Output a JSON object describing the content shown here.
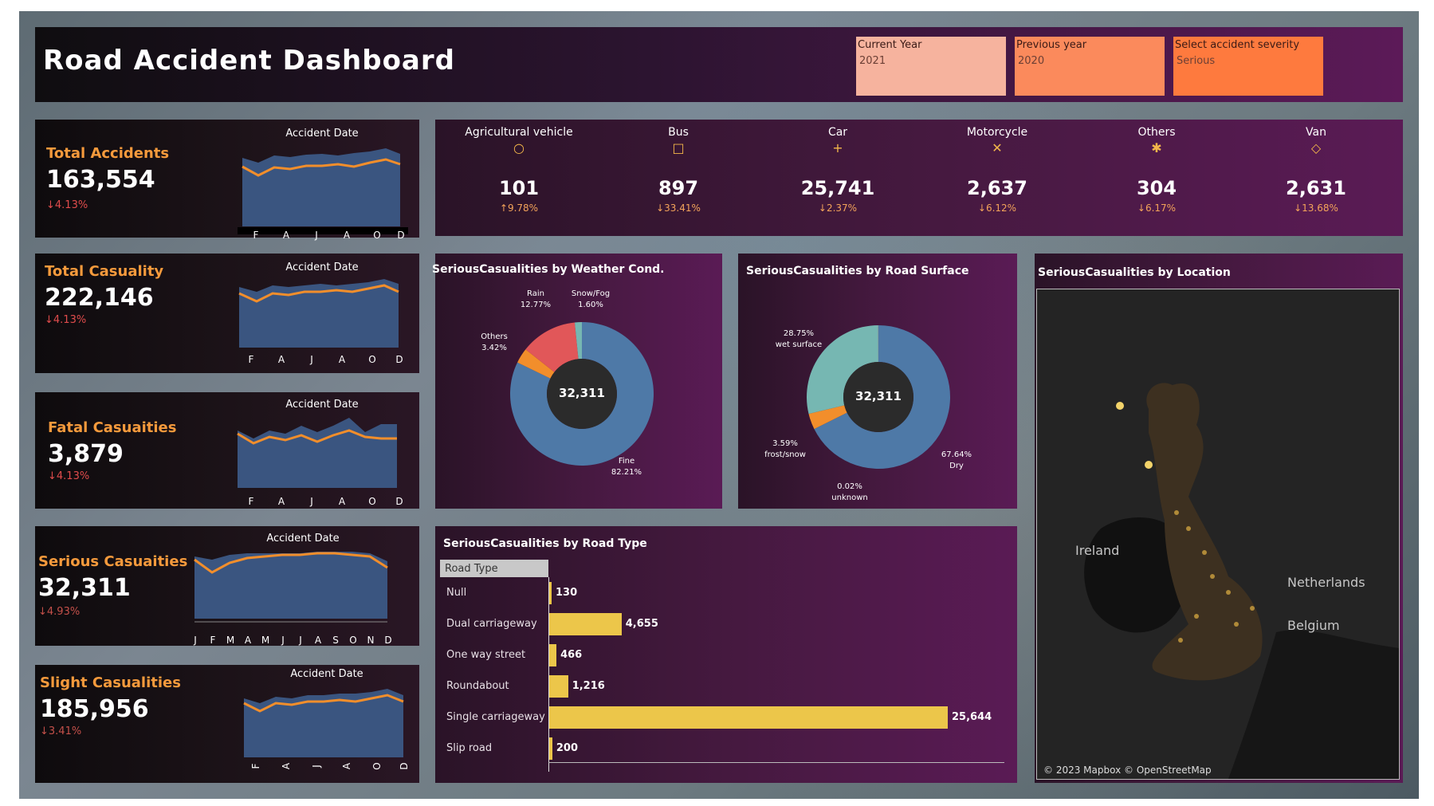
{
  "header": {
    "title": "Road Accident Dashboard",
    "filters": [
      {
        "label": "Current Year",
        "value": "2021",
        "color": "#f6b39e"
      },
      {
        "label": "Previous year",
        "value": "2020",
        "color": "#fb8a5c"
      },
      {
        "label": "Select accident severity",
        "value": "Serious",
        "color": "#fe7a3e"
      }
    ]
  },
  "kpis": {
    "total_accidents": {
      "label": "Total Accidents",
      "value": "163,554",
      "change": "↓4.13%",
      "axis_title": "Accident Date",
      "ticks": [
        "F",
        "A",
        "J",
        "A",
        "O",
        "D"
      ]
    },
    "total_casualty": {
      "label": "Total Casuality",
      "value": "222,146",
      "change": "↓4.13%",
      "axis_title": "Accident Date",
      "ticks": [
        "F",
        "A",
        "J",
        "A",
        "O",
        "D"
      ]
    },
    "fatal": {
      "label": "Fatal Casuaities",
      "value": "3,879",
      "change": "↓4.13%",
      "axis_title": "Accident Date",
      "ticks": [
        "F",
        "A",
        "J",
        "A",
        "O",
        "D"
      ]
    },
    "serious": {
      "label": "Serious Casuaities",
      "value": "32,311",
      "change": "↓4.93%",
      "axis_title": "Accident Date",
      "ticks": [
        "J",
        "F",
        "M",
        "A",
        "M",
        "J",
        "J",
        "A",
        "S",
        "O",
        "N",
        "D"
      ]
    },
    "slight": {
      "label": "Slight Casualities",
      "value": "185,956",
      "change": "↓3.41%",
      "axis_title": "Accident Date",
      "ticks": [
        "F",
        "A",
        "J",
        "A",
        "O",
        "D"
      ]
    }
  },
  "vehicles": [
    {
      "name": "Agricultural vehicle",
      "symbol": "○",
      "value": "101",
      "change": "↑9.78%"
    },
    {
      "name": "Bus",
      "symbol": "□",
      "value": "897",
      "change": "↓33.41%"
    },
    {
      "name": "Car",
      "symbol": "+",
      "value": "25,741",
      "change": "↓2.37%"
    },
    {
      "name": "Motorcycle",
      "symbol": "✕",
      "value": "2,637",
      "change": "↓6.12%"
    },
    {
      "name": "Others",
      "symbol": "✱",
      "value": "304",
      "change": "↓6.17%"
    },
    {
      "name": "Van",
      "symbol": "◇",
      "value": "2,631",
      "change": "↓13.68%"
    }
  ],
  "weather": {
    "title": "SeriousCasualities by Weather Cond.",
    "center": "32,311",
    "labels": [
      {
        "name": "Rain",
        "pct": "12.77%"
      },
      {
        "name": "Snow/Fog",
        "pct": "1.60%"
      },
      {
        "name": "Others",
        "pct": "3.42%"
      },
      {
        "name": "Fine",
        "pct": "82.21%"
      }
    ]
  },
  "surface": {
    "title": "SeriousCasualities by Road Surface",
    "center": "32,311",
    "labels": [
      {
        "name": "wet surface",
        "pct": "28.75%"
      },
      {
        "name": "frost/snow",
        "pct": "3.59%"
      },
      {
        "name": "unknown",
        "pct": "0.02%"
      },
      {
        "name": "Dry",
        "pct": "67.64%"
      }
    ]
  },
  "location": {
    "title": "SeriousCasualities by Location",
    "places": [
      "Ireland",
      "Netherlands",
      "Belgium"
    ],
    "attribution": "© 2023 Mapbox © OpenStreetMap"
  },
  "road_type": {
    "title": "SeriousCasualities by Road Type",
    "header": "Road Type"
  },
  "chart_data": [
    {
      "type": "pie",
      "title": "SeriousCasualities by Weather Cond.",
      "categories": [
        "Fine",
        "Others",
        "Rain",
        "Snow/Fog"
      ],
      "values": [
        82.21,
        3.42,
        12.77,
        1.6
      ],
      "colors": [
        "#4e79a7",
        "#f28e2b",
        "#e15759",
        "#76b7b2"
      ]
    },
    {
      "type": "pie",
      "title": "SeriousCasualities by Road Surface",
      "categories": [
        "Dry",
        "frost/snow",
        "wet surface",
        "unknown"
      ],
      "values": [
        67.64,
        3.59,
        28.75,
        0.02
      ],
      "colors": [
        "#4e79a7",
        "#f28e2b",
        "#76b7b2",
        "#e15759"
      ]
    },
    {
      "type": "bar",
      "title": "SeriousCasualities by Road Type",
      "categories": [
        "Null",
        "Dual carriageway",
        "One way street",
        "Roundabout",
        "Single carriageway",
        "Slip road"
      ],
      "values": [
        130,
        4655,
        466,
        1216,
        25644,
        200
      ],
      "labels": [
        "130",
        "4,655",
        "466",
        "1,216",
        "25,644",
        "200"
      ]
    }
  ]
}
